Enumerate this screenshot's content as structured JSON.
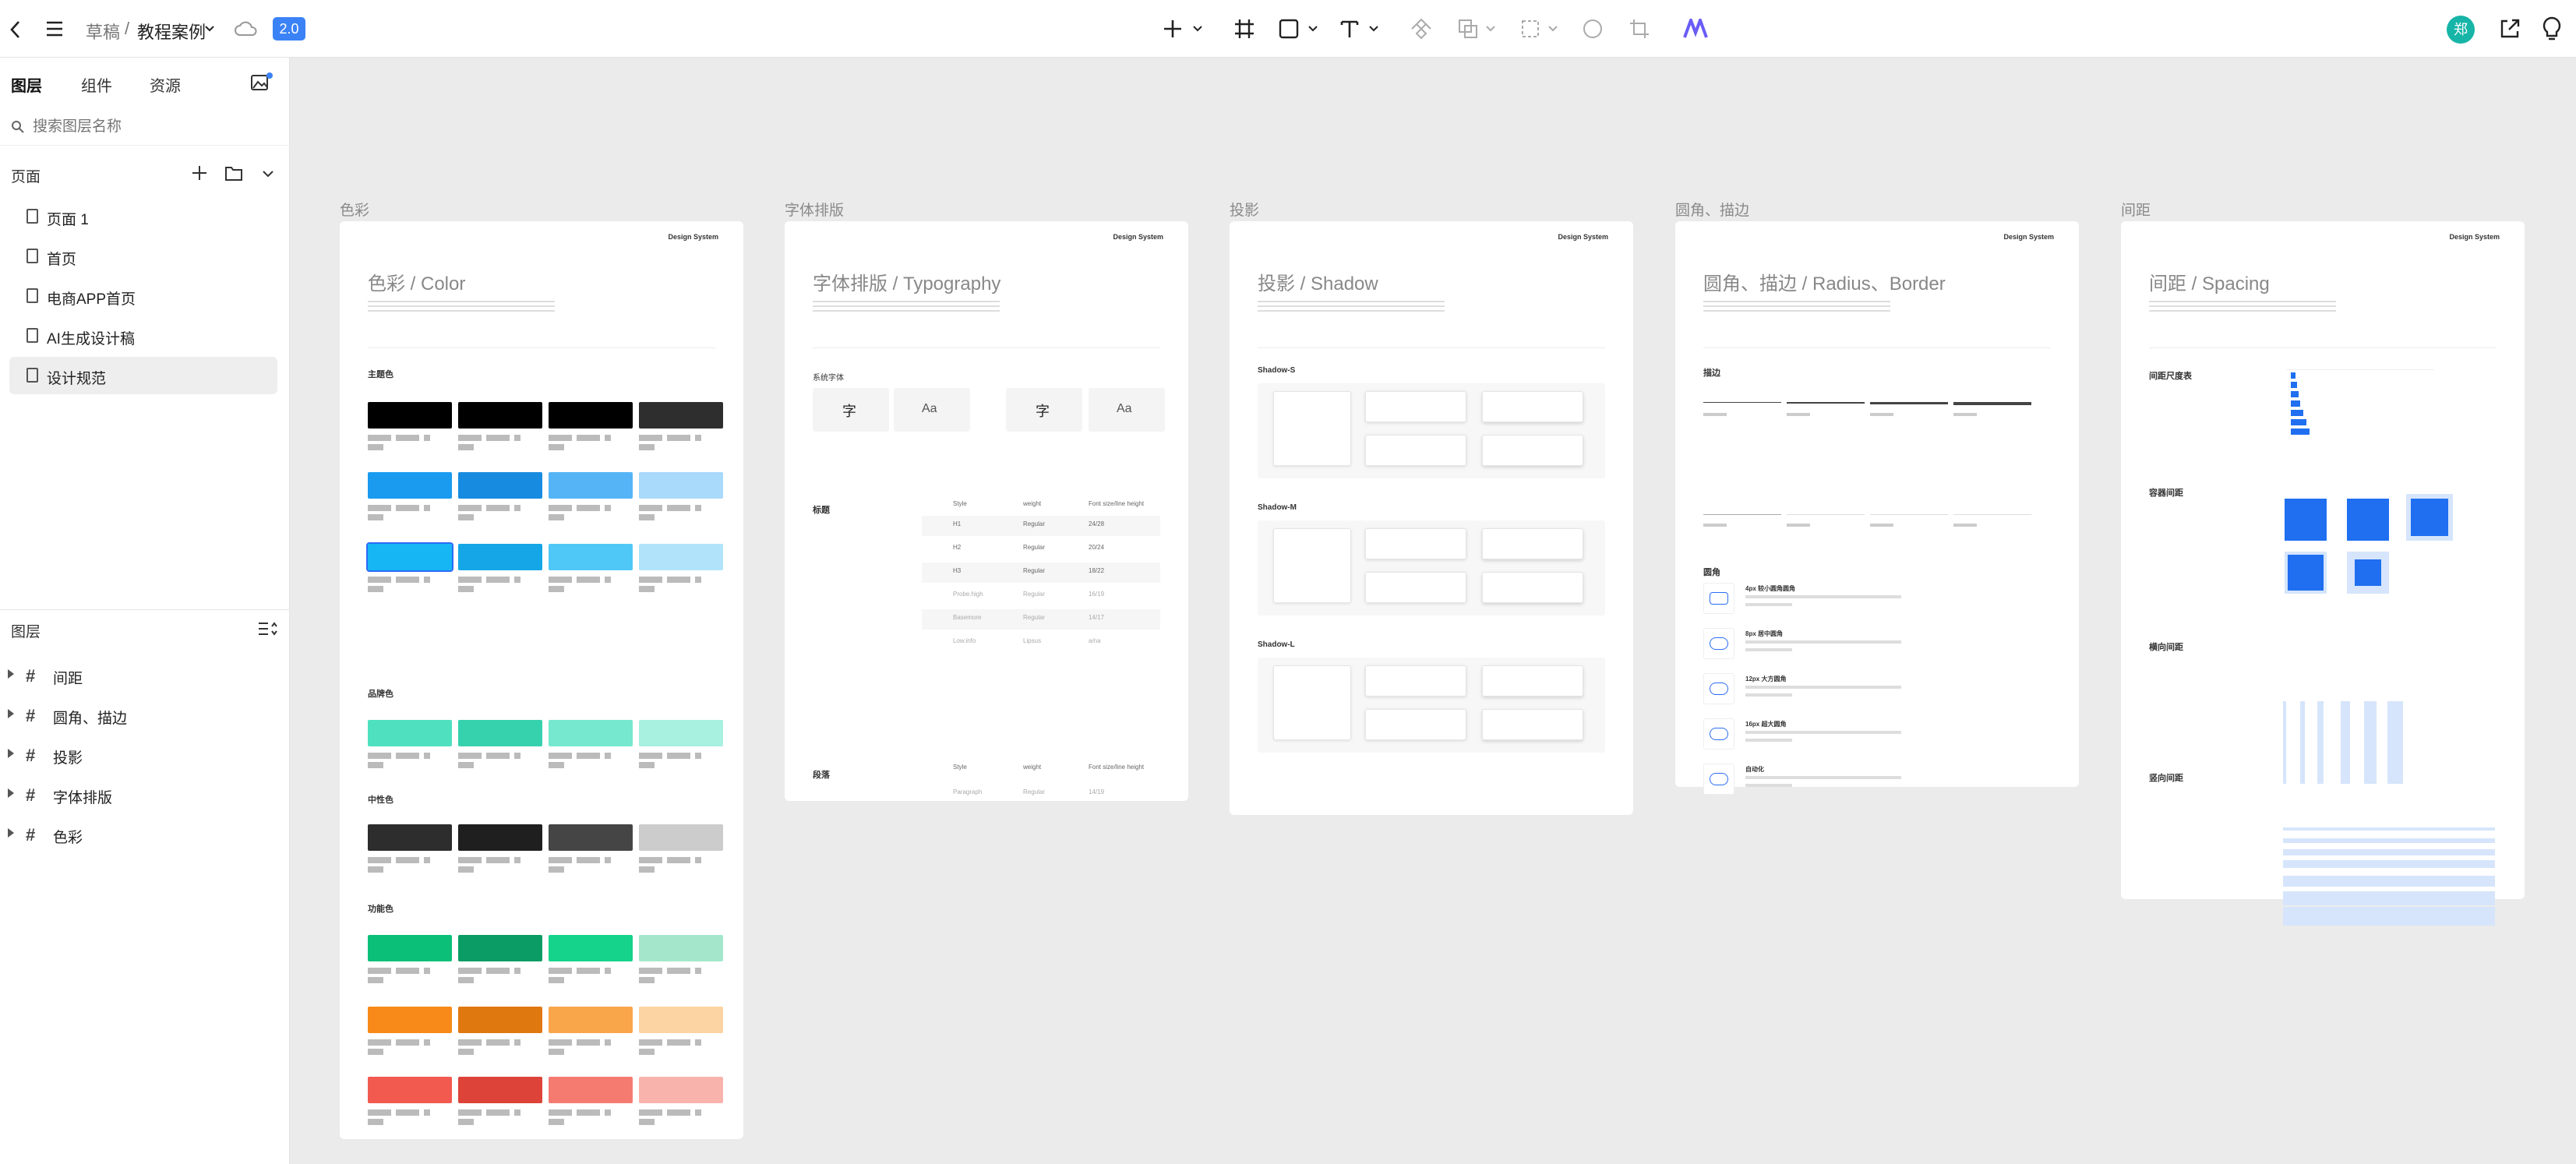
{
  "topbar": {
    "breadcrumb_root": "草稿",
    "breadcrumb_sep": "/",
    "breadcrumb_file": "教程案例",
    "version_badge": "2.0",
    "avatar_text": "郑"
  },
  "left_panel": {
    "tabs": [
      "图层",
      "组件",
      "资源"
    ],
    "search_placeholder": "搜索图层名称",
    "pages_title": "页面",
    "pages": [
      "页面 1",
      "首页",
      "电商APP首页",
      "AI生成设计稿",
      "设计规范"
    ],
    "selected_page_index": 4,
    "layers_title": "图层",
    "layers": [
      "间距",
      "圆角、描边",
      "投影",
      "字体排版",
      "色彩"
    ]
  },
  "frames": [
    {
      "label": "色彩",
      "title": "色彩 / Color",
      "brand": "Design System"
    },
    {
      "label": "字体排版",
      "title": "字体排版 / Typography",
      "brand": "Design System"
    },
    {
      "label": "投影",
      "title": "投影 / Shadow",
      "brand": "Design System"
    },
    {
      "label": "圆角、描边",
      "title": "圆角、描边 / Radius、Border",
      "brand": "Design System"
    },
    {
      "label": "间距",
      "title": "间距 / Spacing",
      "brand": "Design System"
    }
  ],
  "color_frame": {
    "sections": [
      "主题色",
      "品牌色",
      "中性色",
      "功能色"
    ],
    "colors": {
      "primary": [
        "#000000",
        "#000000",
        "#000000",
        "#2e2e2e"
      ],
      "secondary": [
        "#1a9bf0",
        "#178be0",
        "#55b4f6",
        "#a9d9fb"
      ],
      "tertiary": [
        "#16b6f5",
        "#14a6e6",
        "#4fc8f7",
        "#b1e4fb"
      ],
      "brand": [
        "#4fe0c0",
        "#36d1ad",
        "#75e8cf",
        "#a8f0df"
      ],
      "neutral": [
        "#2d2d2d",
        "#1f1f1f",
        "#454545",
        "#cccccc"
      ],
      "success": [
        "#0bbf78",
        "#0a9c64",
        "#15d38a",
        "#a4e6cb"
      ],
      "warning": [
        "#f78a18",
        "#e07810",
        "#f9a54a",
        "#fcd3a3"
      ],
      "danger": [
        "#f25a4f",
        "#dd4338",
        "#f57b71",
        "#f9b3ad"
      ]
    }
  },
  "typography_frame": {
    "sys_font_title": "系统字体",
    "glyph_cn": "字",
    "glyph_en": "Aa",
    "heading_label": "标题",
    "para_label": "段落",
    "table_headers": [
      "Style",
      "weight",
      "Font size/line height"
    ],
    "rows": [
      [
        "H1",
        "Regular",
        "24/28"
      ],
      [
        "H2",
        "Regular",
        "20/24"
      ],
      [
        "H3",
        "Regular",
        "18/22"
      ],
      [
        "Probe.high",
        "Regular",
        "16/19"
      ],
      [
        "Basemore",
        "Regular",
        "14/17"
      ],
      [
        "Low.info",
        "Lipsus",
        "a/na"
      ]
    ],
    "para_row": [
      "Paragraph",
      "Regular",
      "14/19"
    ]
  },
  "shadow_frame": {
    "sections": [
      "Shadow-S",
      "Shadow-M",
      "Shadow-L"
    ]
  },
  "radius_frame": {
    "stroke_title": "描边",
    "radius_title": "圆角",
    "radius_items": [
      "4px 较小圆角圆角",
      "8px 居中圆角",
      "12px 大方圆角",
      "16px 超大圆角",
      "自动化"
    ]
  },
  "spacing_frame": {
    "sections": [
      "间距尺度表",
      "容器间距",
      "横向间距",
      "竖向间距"
    ]
  }
}
